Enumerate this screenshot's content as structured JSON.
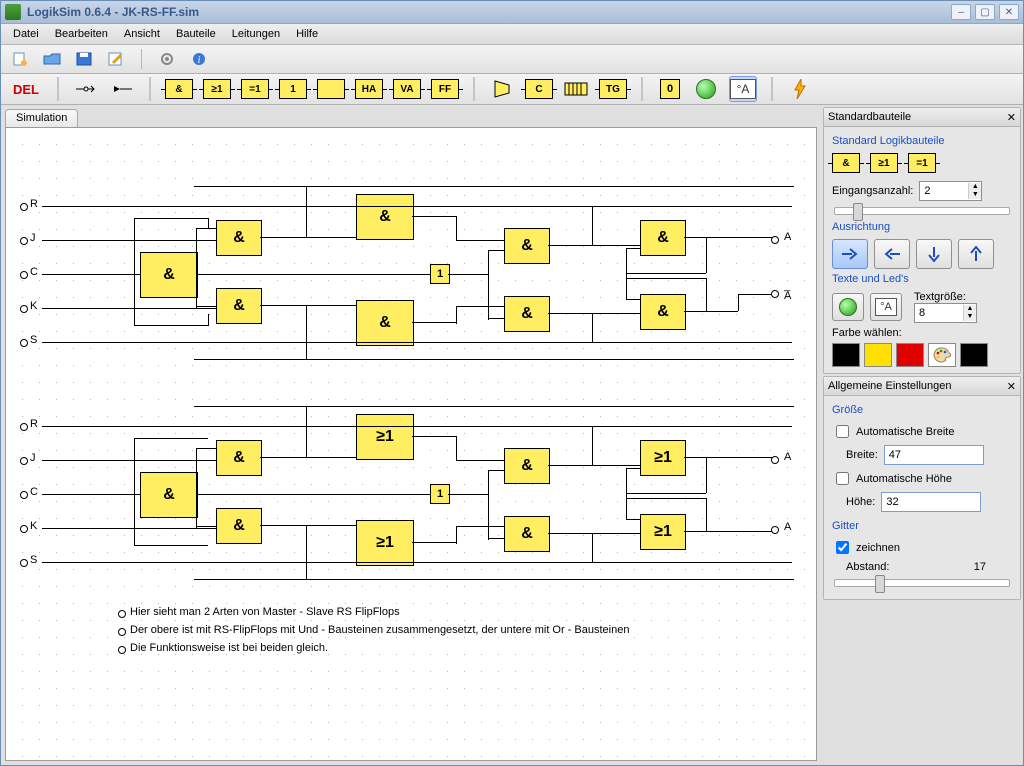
{
  "title": "LogikSim 0.6.4 - JK-RS-FF.sim",
  "menu": [
    "Datei",
    "Bearbeiten",
    "Ansicht",
    "Bauteile",
    "Leitungen",
    "Hilfe"
  ],
  "toolbar_icons": [
    "new",
    "open",
    "save",
    "edit",
    "cog",
    "info"
  ],
  "componentbar": {
    "del": "DEL",
    "groups": [
      [
        "pin-in",
        "pin-out"
      ],
      [
        "&",
        "≥1",
        "=1",
        "1",
        " ",
        "HA",
        "VA",
        "FF"
      ],
      [
        "mux",
        "C",
        "shiftreg",
        "TG"
      ],
      [
        "0",
        "led",
        "°A"
      ],
      [
        "lightning"
      ]
    ]
  },
  "tab_name": "Simulation",
  "side": {
    "std": {
      "title": "Standardbauteile",
      "sub1": "Standard Logikbauteile",
      "gates": [
        "&",
        "≥1",
        "=1"
      ],
      "inputs_lbl": "Eingangsanzahl:",
      "inputs": "2",
      "align_title": "Ausrichtung",
      "text_title": "Texte und Led's",
      "textsize_lbl": "Textgröße:",
      "textsize": "8",
      "color_lbl": "Farbe wählen:",
      "swatches": [
        "#000000",
        "#ffe000",
        "#e00000"
      ],
      "extra_sw": "#000000"
    },
    "gen": {
      "title": "Allgemeine Einstellungen",
      "size_title": "Größe",
      "auto_w": "Automatische Breite",
      "w_lbl": "Breite:",
      "w": "47",
      "auto_h": "Automatische Höhe",
      "h_lbl": "Höhe:",
      "h": "32",
      "grid_title": "Gitter",
      "draw": "zeichnen",
      "spacing_lbl": "Abstand:",
      "spacing": "17"
    }
  },
  "circuit": {
    "inputs_top": [
      "R",
      "J",
      "C",
      "K",
      "S"
    ],
    "inputs_bot": [
      "R",
      "J",
      "C",
      "K",
      "S"
    ],
    "outputs": [
      "A",
      "_",
      "A",
      "A"
    ],
    "gates_top": [
      "&",
      "&",
      "&",
      "&",
      "&",
      "1",
      "&",
      "&",
      "&",
      "&"
    ],
    "gates_bot": [
      "&",
      "&",
      "&",
      "≥1",
      "≥1",
      "1",
      "&",
      "&",
      "≥1",
      "≥1"
    ],
    "notes": [
      "Hier sieht man 2 Arten von Master - Slave RS FlipFlops",
      "Der obere ist mit RS-FlipFlops mit Und - Bausteinen zusammengesetzt, der untere mit Or - Bausteinen",
      "Die Funktionsweise ist bei beiden gleich."
    ]
  }
}
